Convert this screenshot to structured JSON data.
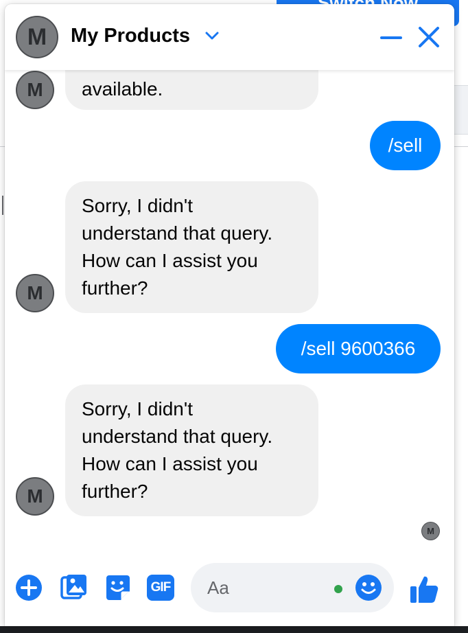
{
  "background": {
    "switch_button_label": "Switch Now"
  },
  "header": {
    "avatar_letter": "M",
    "title": "My Products"
  },
  "messages": [
    {
      "from": "bot",
      "text": "available."
    },
    {
      "from": "user",
      "text": "/sell"
    },
    {
      "from": "bot",
      "lines": [
        "Sorry, I didn't",
        "understand that query.",
        "How can I assist you",
        "further?"
      ]
    },
    {
      "from": "user",
      "text": "/sell 9600366"
    },
    {
      "from": "bot",
      "lines": [
        "Sorry, I didn't",
        "understand that query.",
        "How can I assist you",
        "further?"
      ]
    }
  ],
  "bot_avatar_letter": "M",
  "seen_avatar_letter": "M",
  "composer": {
    "placeholder": "Aa",
    "gif_label": "GIF",
    "icons": [
      "plus-circle-icon",
      "photo-icon",
      "sticker-icon",
      "gif-icon",
      "emoji-icon",
      "thumbs-up-icon"
    ]
  },
  "colors": {
    "accent": "#0084ff",
    "icon_blue": "#1877f2",
    "incoming_bubble": "#f0f0f0",
    "online_dot": "#31a24c"
  }
}
